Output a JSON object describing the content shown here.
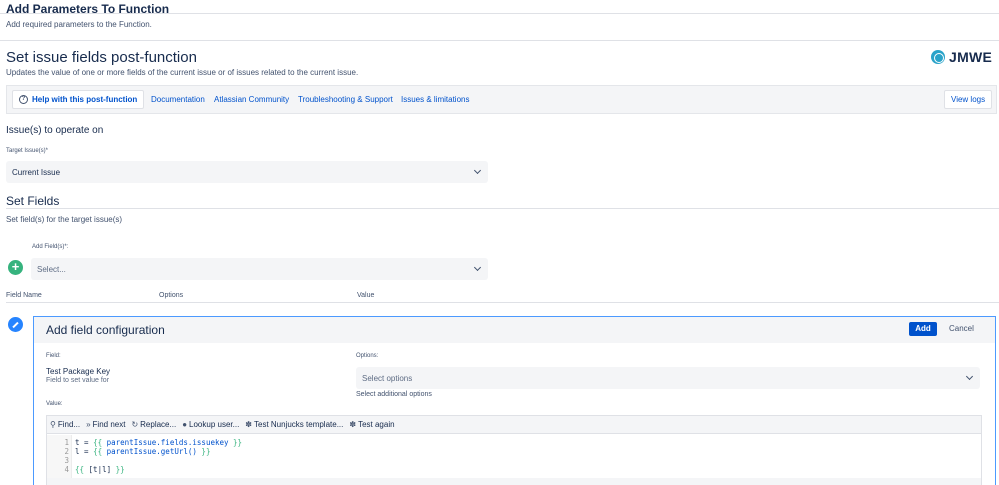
{
  "header": {
    "title": "Add Parameters To Function",
    "subtitle": "Add required parameters to the Function."
  },
  "postfunction": {
    "title": "Set issue fields post-function",
    "description": "Updates the value of one or more fields of the current issue or of issues related to the current issue.",
    "logo_text": "JMWE",
    "brand_color": "#2aa3c9"
  },
  "links": {
    "help": "Help with this post-function",
    "documentation": "Documentation",
    "community": "Atlassian Community",
    "troubleshooting": "Troubleshooting & Support",
    "issues": "Issues & limitations",
    "view_logs": "View logs"
  },
  "operate": {
    "section_title": "Issue(s) to operate on",
    "target_label": "Target Issue(s)*",
    "target_value": "Current Issue"
  },
  "set_fields": {
    "title": "Set Fields",
    "description": "Set field(s) for the target issue(s)",
    "add_label": "Add Field(s)*:",
    "add_placeholder": "Select..."
  },
  "table": {
    "columns": [
      "Field Name",
      "Options",
      "Value"
    ]
  },
  "config": {
    "title": "Add field configuration",
    "add_button": "Add",
    "cancel_button": "Cancel",
    "field_label": "Field:",
    "field_name": "Test Package Key",
    "field_desc": "Field to set value for",
    "options_label": "Options:",
    "options_placeholder": "Select options",
    "options_hint": "Select additional options",
    "value_label": "Value:"
  },
  "toolbar": {
    "find": "Find...",
    "find_next": "Find next",
    "replace": "Replace...",
    "lookup_user": "Lookup user...",
    "test_nunjucks": "Test Nunjucks template...",
    "test_again": "Test again"
  },
  "code": {
    "lines": [
      {
        "num": "1",
        "var": "t = ",
        "tag_open": "{{ ",
        "obj": "parentIssue.fields.issuekey",
        "tag_close": " }}"
      },
      {
        "num": "2",
        "var": "l = ",
        "tag_open": "{{ ",
        "obj": "parentIssue.getUrl()",
        "tag_close": " }}"
      },
      {
        "num": "3",
        "var": "",
        "tag_open": "",
        "obj": "",
        "tag_close": ""
      },
      {
        "num": "4",
        "var": "",
        "tag_open": "{{ ",
        "obj": "[t|l]",
        "tag_close": " }}"
      }
    ]
  },
  "colors": {
    "primary": "#0052cc",
    "success": "#36b37e",
    "info": "#2684ff"
  }
}
